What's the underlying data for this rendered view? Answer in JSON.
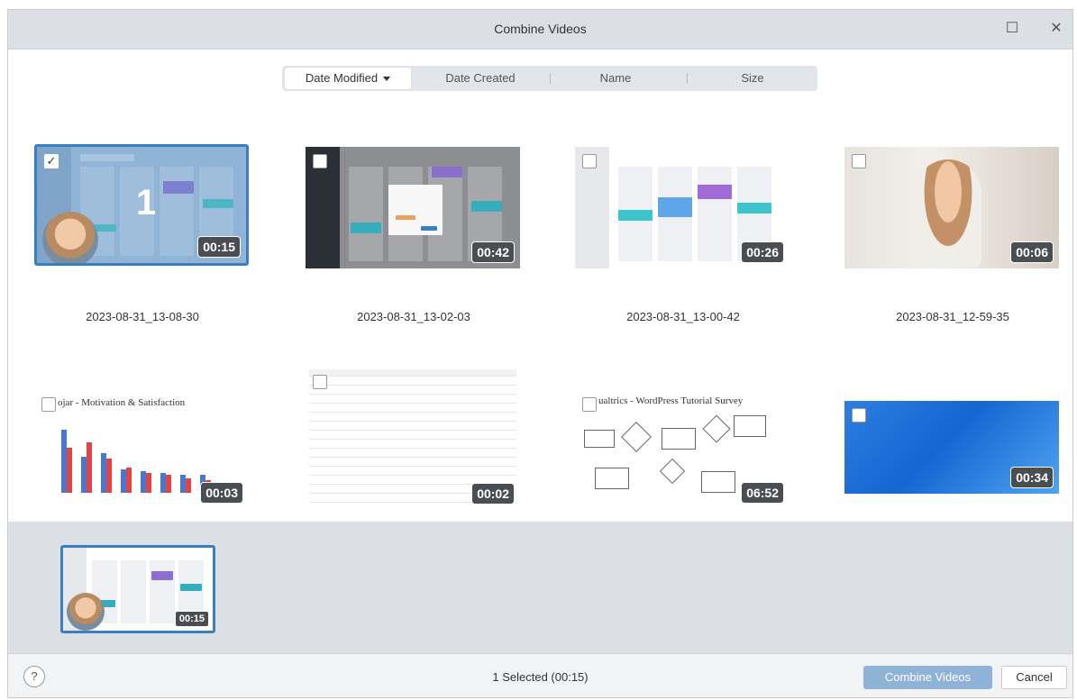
{
  "window": {
    "title": "Combine Videos"
  },
  "sort": {
    "options": [
      "Date Modified",
      "Date Created",
      "Name",
      "Size"
    ],
    "active": "Date Modified"
  },
  "videos": [
    {
      "name": "2023-08-31_13-08-30",
      "duration": "00:15",
      "selected": true,
      "order": "1"
    },
    {
      "name": "2023-08-31_13-02-03",
      "duration": "00:42",
      "selected": false
    },
    {
      "name": "2023-08-31_13-00-42",
      "duration": "00:26",
      "selected": false
    },
    {
      "name": "2023-08-31_12-59-35",
      "duration": "00:06",
      "selected": false
    },
    {
      "name": "",
      "duration": "00:03",
      "selected": false,
      "preview_title": "ojar - Motivation & Satisfaction"
    },
    {
      "name": "",
      "duration": "00:02",
      "selected": false
    },
    {
      "name": "",
      "duration": "06:52",
      "selected": false,
      "preview_title": "ualtrics - WordPress Tutorial Survey"
    },
    {
      "name": "",
      "duration": "00:34",
      "selected": false
    }
  ],
  "tray": {
    "items": [
      {
        "duration": "00:15"
      }
    ]
  },
  "footer": {
    "help": "?",
    "status": "1 Selected (00:15)",
    "combine_label": "Combine Videos",
    "cancel_label": "Cancel"
  },
  "colors": {
    "accent": "#3a7fc1",
    "combine_disabled": "#8fb3d6"
  },
  "icons": {
    "maximize": "maximize-icon",
    "close": "close-icon",
    "checkmark": "checkmark-icon"
  }
}
